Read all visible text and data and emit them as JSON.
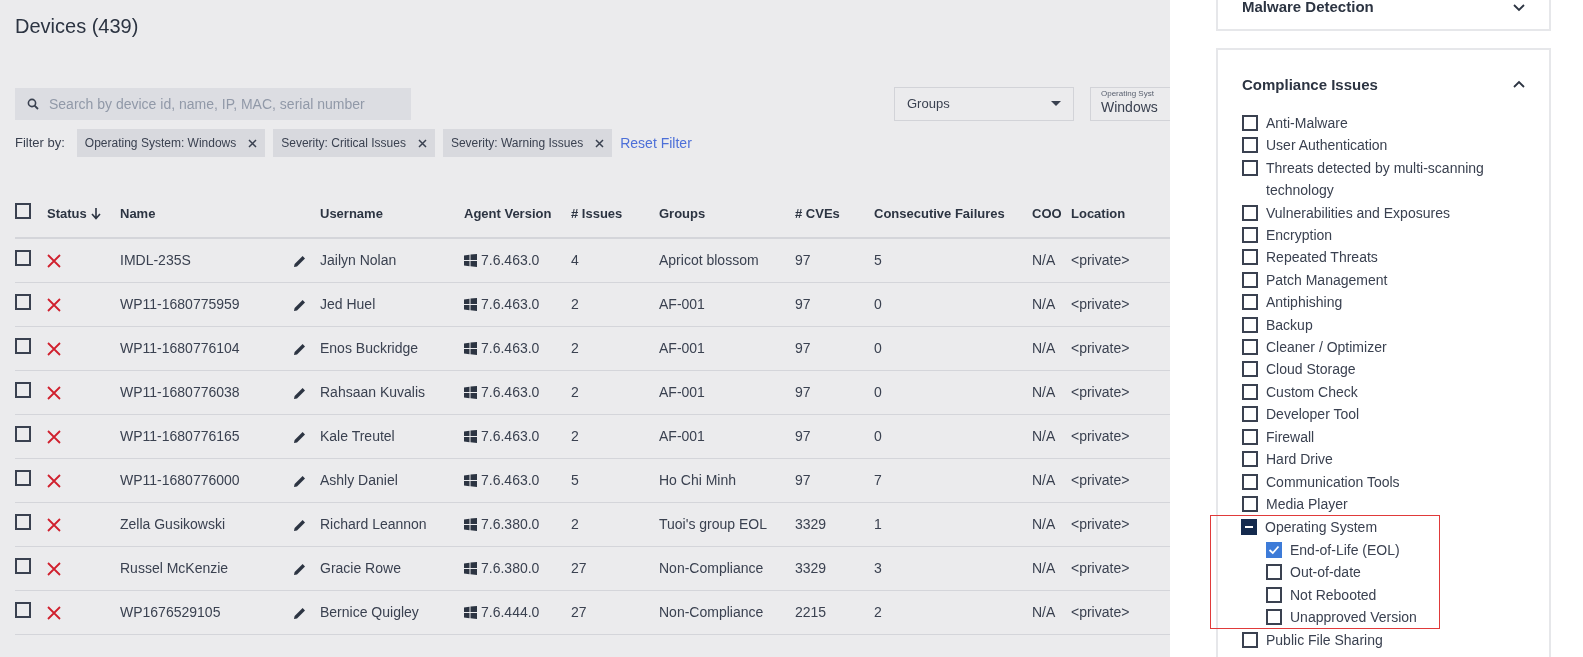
{
  "page": {
    "title": "Devices (439)"
  },
  "search": {
    "placeholder": "Search by device id, name, IP, MAC, serial number"
  },
  "filters": {
    "groups_dropdown": {
      "value": "Groups"
    },
    "os_dropdown": {
      "label": "Operating Syst",
      "value": "Windows"
    }
  },
  "active_filters": {
    "label": "Filter by:",
    "chips": [
      "Operating System: Windows",
      "Severity: Critical Issues",
      "Severity: Warning Issues"
    ],
    "reset": "Reset Filter"
  },
  "table": {
    "select_all_checked": false,
    "columns": [
      {
        "label": "Status",
        "sorted": true
      },
      {
        "label": "Name",
        "sorted": false
      },
      {
        "label": "Username",
        "sorted": false
      },
      {
        "label": "Agent Version",
        "sorted": false
      },
      {
        "label": "# Issues",
        "sorted": false
      },
      {
        "label": "Groups",
        "sorted": false
      },
      {
        "label": "# CVEs",
        "sorted": false
      },
      {
        "label": "Consecutive Failures",
        "sorted": false
      },
      {
        "label": "COO",
        "sorted": false
      },
      {
        "label": "Location",
        "sorted": false
      }
    ],
    "rows": [
      {
        "checked": false,
        "critical": true,
        "name": "IMDL-235S",
        "username": "Jailyn Nolan",
        "agent": "7.6.463.0",
        "issues": "4",
        "groups": "Apricot blossom",
        "cves": "97",
        "failures": "5",
        "coo": "N/A",
        "location": "<private>"
      },
      {
        "checked": false,
        "critical": true,
        "name": "WP11-1680775959",
        "username": "Jed Huel",
        "agent": "7.6.463.0",
        "issues": "2",
        "groups": "AF-001",
        "cves": "97",
        "failures": "0",
        "coo": "N/A",
        "location": "<private>"
      },
      {
        "checked": false,
        "critical": true,
        "name": "WP11-1680776104",
        "username": "Enos Buckridge",
        "agent": "7.6.463.0",
        "issues": "2",
        "groups": "AF-001",
        "cves": "97",
        "failures": "0",
        "coo": "N/A",
        "location": "<private>"
      },
      {
        "checked": false,
        "critical": true,
        "name": "WP11-1680776038",
        "username": "Rahsaan Kuvalis",
        "agent": "7.6.463.0",
        "issues": "2",
        "groups": "AF-001",
        "cves": "97",
        "failures": "0",
        "coo": "N/A",
        "location": "<private>"
      },
      {
        "checked": false,
        "critical": true,
        "name": "WP11-1680776165",
        "username": "Kale Treutel",
        "agent": "7.6.463.0",
        "issues": "2",
        "groups": "AF-001",
        "cves": "97",
        "failures": "0",
        "coo": "N/A",
        "location": "<private>"
      },
      {
        "checked": false,
        "critical": true,
        "name": "WP11-1680776000",
        "username": "Ashly Daniel",
        "agent": "7.6.463.0",
        "issues": "5",
        "groups": "Ho Chi Minh",
        "cves": "97",
        "failures": "7",
        "coo": "N/A",
        "location": "<private>"
      },
      {
        "checked": false,
        "critical": true,
        "name": "Zella Gusikowski",
        "username": "Richard Leannon",
        "agent": "7.6.380.0",
        "issues": "2",
        "groups": "Tuoi's group EOL",
        "cves": "3329",
        "failures": "1",
        "coo": "N/A",
        "location": "<private>"
      },
      {
        "checked": false,
        "critical": true,
        "name": "Russel McKenzie",
        "username": "Gracie Rowe",
        "agent": "7.6.380.0",
        "issues": "27",
        "groups": "Non-Compliance",
        "cves": "3329",
        "failures": "3",
        "coo": "N/A",
        "location": "<private>"
      },
      {
        "checked": false,
        "critical": true,
        "name": "WP1676529105",
        "username": "Bernice Quigley",
        "agent": "7.6.444.0",
        "issues": "27",
        "groups": "Non-Compliance",
        "cves": "2215",
        "failures": "2",
        "coo": "N/A",
        "location": "<private>"
      }
    ]
  },
  "filter_panel": {
    "sections": [
      {
        "title": "Malware Detection",
        "expanded": false
      },
      {
        "title": "Compliance Issues",
        "expanded": true,
        "items": [
          {
            "label": "Anti-Malware",
            "checked": false,
            "indeterminate": false,
            "highlighted": false
          },
          {
            "label": "User Authentication",
            "checked": false,
            "indeterminate": false,
            "highlighted": false
          },
          {
            "label": "Threats detected by multi-scanning technology",
            "checked": false,
            "indeterminate": false,
            "highlighted": false
          },
          {
            "label": "Vulnerabilities and Exposures",
            "checked": false,
            "indeterminate": false,
            "highlighted": false
          },
          {
            "label": "Encryption",
            "checked": false,
            "indeterminate": false,
            "highlighted": false
          },
          {
            "label": "Repeated Threats",
            "checked": false,
            "indeterminate": false,
            "highlighted": false
          },
          {
            "label": "Patch Management",
            "checked": false,
            "indeterminate": false,
            "highlighted": false
          },
          {
            "label": "Antiphishing",
            "checked": false,
            "indeterminate": false,
            "highlighted": false
          },
          {
            "label": "Backup",
            "checked": false,
            "indeterminate": false,
            "highlighted": false
          },
          {
            "label": "Cleaner / Optimizer",
            "checked": false,
            "indeterminate": false,
            "highlighted": false
          },
          {
            "label": "Cloud Storage",
            "checked": false,
            "indeterminate": false,
            "highlighted": false
          },
          {
            "label": "Custom Check",
            "checked": false,
            "indeterminate": false,
            "highlighted": false
          },
          {
            "label": "Developer Tool",
            "checked": false,
            "indeterminate": false,
            "highlighted": false
          },
          {
            "label": "Firewall",
            "checked": false,
            "indeterminate": false,
            "highlighted": false
          },
          {
            "label": "Hard Drive",
            "checked": false,
            "indeterminate": false,
            "highlighted": false
          },
          {
            "label": "Communication Tools",
            "checked": false,
            "indeterminate": false,
            "highlighted": false
          },
          {
            "label": "Media Player",
            "checked": false,
            "indeterminate": false,
            "highlighted": false
          },
          {
            "label": "Operating System",
            "indeterminate": true,
            "highlighted": true,
            "children": [
              {
                "label": "End-of-Life (EOL)",
                "checked": true
              },
              {
                "label": "Out-of-date",
                "checked": false
              },
              {
                "label": "Not Rebooted",
                "checked": false
              },
              {
                "label": "Unapproved Version",
                "checked": false
              }
            ]
          },
          {
            "label": "Public File Sharing",
            "checked": false,
            "indeterminate": false,
            "highlighted": false
          }
        ]
      }
    ]
  }
}
